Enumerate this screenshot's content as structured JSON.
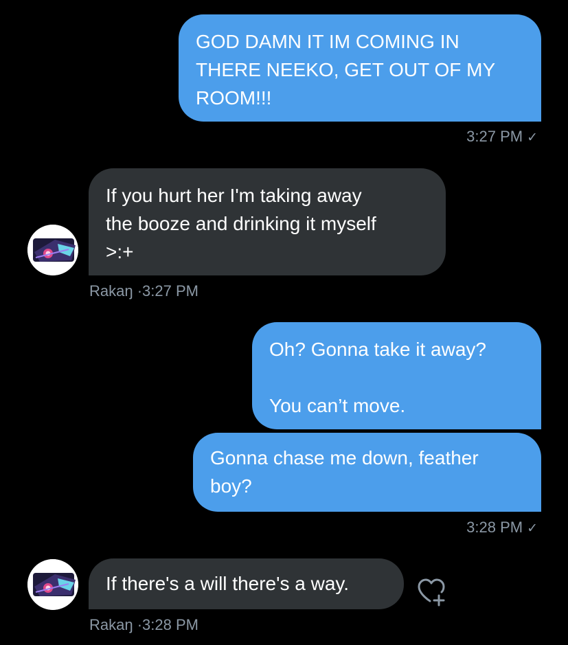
{
  "conversation": {
    "messages": [
      {
        "direction": "sent",
        "text": "GOD DAMN IT IM COMING IN\nTHERE NEEKO, GET OUT OF MY\nROOM!!!"
      },
      {
        "direction": "received",
        "text": "If you hurt her I'm taking away\nthe booze and drinking it myself\n>:+"
      },
      {
        "direction": "sent",
        "text": "Oh? Gonna take it away?\n\nYou can’t move."
      },
      {
        "direction": "sent",
        "text": "Gonna chase me down, feather\nboy?"
      },
      {
        "direction": "received",
        "text": "If there's a will there's a way."
      }
    ],
    "meta": [
      {
        "time": "3:27 PM",
        "check": "✓"
      },
      {
        "sender": "Rakaŋ",
        "separator": "·",
        "time": "3:27 PM"
      },
      {
        "time": "3:28 PM",
        "check": "✓"
      },
      {
        "sender": "Rakaŋ",
        "separator": "·",
        "time": "3:28 PM"
      }
    ]
  },
  "icons": {
    "avatar": "avatar-image",
    "react": "heart-plus-icon"
  },
  "colors": {
    "background": "#000000",
    "sent_bubble": "#4c9eeb",
    "received_bubble": "#2f3336",
    "meta_text": "#8b98a5"
  }
}
